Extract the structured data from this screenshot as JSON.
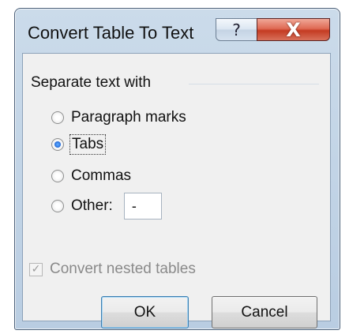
{
  "window": {
    "title": "Convert Table To Text",
    "help_label": "?",
    "close_label": "X"
  },
  "group": {
    "label": "Separate text with",
    "options": [
      {
        "label": "Paragraph marks",
        "selected": false
      },
      {
        "label": "Tabs",
        "selected": true
      },
      {
        "label": "Commas",
        "selected": false
      },
      {
        "label": "Other:",
        "selected": false
      }
    ],
    "other_value": "-"
  },
  "nested": {
    "label": "Convert nested tables",
    "checked": true,
    "enabled": false
  },
  "buttons": {
    "ok": "OK",
    "cancel": "Cancel"
  }
}
